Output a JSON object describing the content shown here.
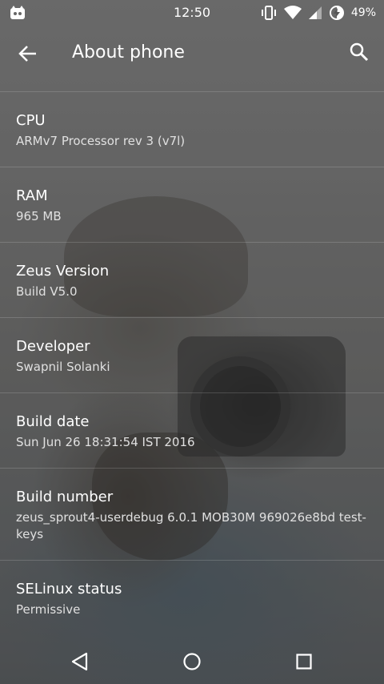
{
  "status_bar": {
    "time": "12:50",
    "battery_percent": "49%",
    "icons": [
      "notification-app-icon",
      "vibrate-icon",
      "wifi-icon",
      "signal-icon",
      "battery-charging-icon"
    ]
  },
  "toolbar": {
    "title": "About phone",
    "back_icon": "arrow-back-icon",
    "search_icon": "search-icon"
  },
  "items": [
    {
      "title": "CPU",
      "summary": "ARMv7 Processor rev 3 (v7l)"
    },
    {
      "title": "RAM",
      "summary": "965 MB"
    },
    {
      "title": "Zeus Version",
      "summary": "Build V5.0"
    },
    {
      "title": "Developer",
      "summary": "Swapnil Solanki"
    },
    {
      "title": "Build date",
      "summary": "Sun Jun 26 18:31:54 IST 2016"
    },
    {
      "title": "Build number",
      "summary": "zeus_sprout4-userdebug 6.0.1 MOB30M 969026e8bd test-keys"
    },
    {
      "title": "SELinux status",
      "summary": "Permissive"
    }
  ],
  "nav_bar": {
    "icons": [
      "back-triangle-icon",
      "home-circle-icon",
      "recents-square-icon"
    ]
  }
}
